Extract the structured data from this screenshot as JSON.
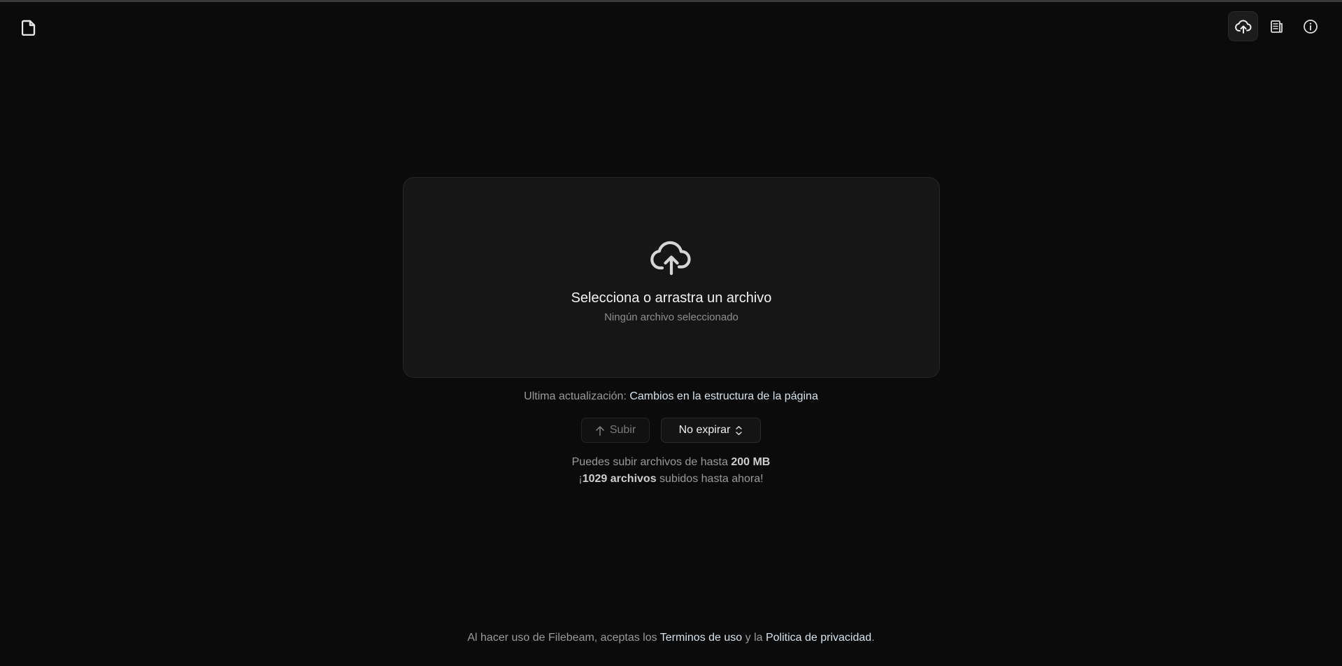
{
  "header": {
    "logo_icon": "file-icon",
    "toolbar": [
      {
        "icon": "cloud-upload-icon",
        "active": true
      },
      {
        "icon": "newspaper-icon",
        "active": false
      },
      {
        "icon": "info-icon",
        "active": false
      }
    ]
  },
  "dropzone": {
    "icon": "cloud-upload-icon",
    "title": "Selecciona o arrastra un archivo",
    "subtitle": "Ningún archivo seleccionado"
  },
  "update": {
    "label": "Ultima actualización:",
    "link_text": "Cambios en la estructura de la página"
  },
  "actions": {
    "upload_label": "Subir",
    "expire_label": "No expirar"
  },
  "limits": {
    "prefix": "Puedes subir archivos de hasta",
    "max_size": "200 MB",
    "count_prefix": "¡",
    "count": "1029 archivos",
    "count_suffix": "subidos hasta ahora!"
  },
  "footer": {
    "prefix": "Al hacer uso de Filebeam, aceptas los",
    "terms": "Terminos de uso",
    "middle": "y la",
    "privacy": "Politica de privacidad",
    "end": "."
  },
  "colors": {
    "background": "#0b0b0b",
    "panel": "#161616",
    "link": "#d8e2ea"
  }
}
